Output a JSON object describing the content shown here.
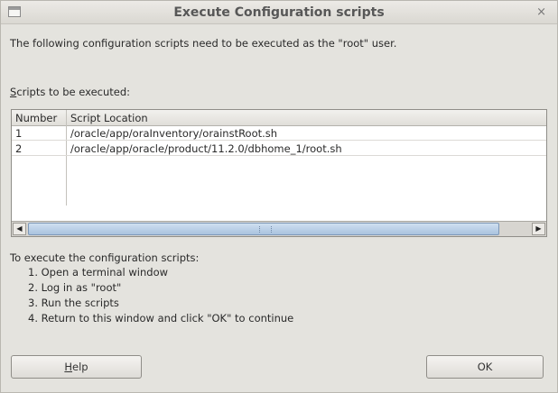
{
  "window": {
    "title": "Execute Configuration scripts",
    "close_glyph": "×",
    "icon": "window-icon"
  },
  "intro_text": "The following configuration scripts need to be executed as the \"root\" user.",
  "scripts_label": {
    "mnemonic": "S",
    "rest": "cripts to be executed:"
  },
  "table": {
    "columns": [
      "Number",
      "Script Location"
    ],
    "rows": [
      {
        "number": "1",
        "location": "/oracle/app/oraInventory/orainstRoot.sh"
      },
      {
        "number": "2",
        "location": "/oracle/app/oracle/product/11.2.0/dbhome_1/root.sh"
      }
    ],
    "scroll_left_glyph": "◀",
    "scroll_right_glyph": "▶"
  },
  "instructions": {
    "title": "To execute the configuration scripts:",
    "steps": [
      "1. Open a terminal window",
      "2. Log in as \"root\"",
      "3. Run the scripts",
      "4. Return to this window and click \"OK\" to continue"
    ]
  },
  "buttons": {
    "help": {
      "mnemonic": "H",
      "rest": "elp"
    },
    "ok": "OK"
  }
}
